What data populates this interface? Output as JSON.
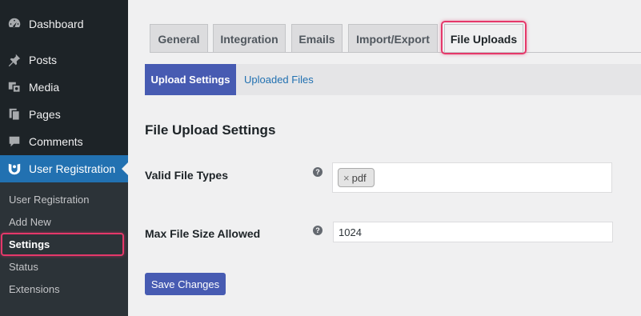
{
  "sidebar": {
    "menu": [
      {
        "label": "Dashboard",
        "icon": "dashboard-icon"
      },
      {
        "label": "Posts",
        "icon": "pushpin-icon"
      },
      {
        "label": "Media",
        "icon": "media-icon"
      },
      {
        "label": "Pages",
        "icon": "pages-icon"
      },
      {
        "label": "Comments",
        "icon": "comment-icon"
      },
      {
        "label": "User Registration",
        "icon": "user-registration-icon"
      }
    ],
    "submenu": [
      "User Registration",
      "Add New",
      "Settings",
      "Status",
      "Extensions"
    ],
    "current_submenu": "Settings"
  },
  "tabs": [
    "General",
    "Integration",
    "Emails",
    "Import/Export",
    "File Uploads"
  ],
  "active_tab": "File Uploads",
  "subnav": {
    "active": "Upload Settings",
    "link": "Uploaded Files"
  },
  "section_title": "File Upload Settings",
  "fields": {
    "file_types": {
      "label": "Valid File Types",
      "tokens": [
        "pdf"
      ],
      "remove_glyph": "×"
    },
    "max_size": {
      "label": "Max File Size Allowed",
      "value": "1024"
    }
  },
  "help_glyph": "?",
  "save_label": "Save Changes",
  "colors": {
    "sidebar_bg": "#1d2327",
    "active_menu": "#2271b1",
    "accent_button": "#475bb2",
    "highlight": "#e5386a",
    "link": "#2271b1"
  }
}
